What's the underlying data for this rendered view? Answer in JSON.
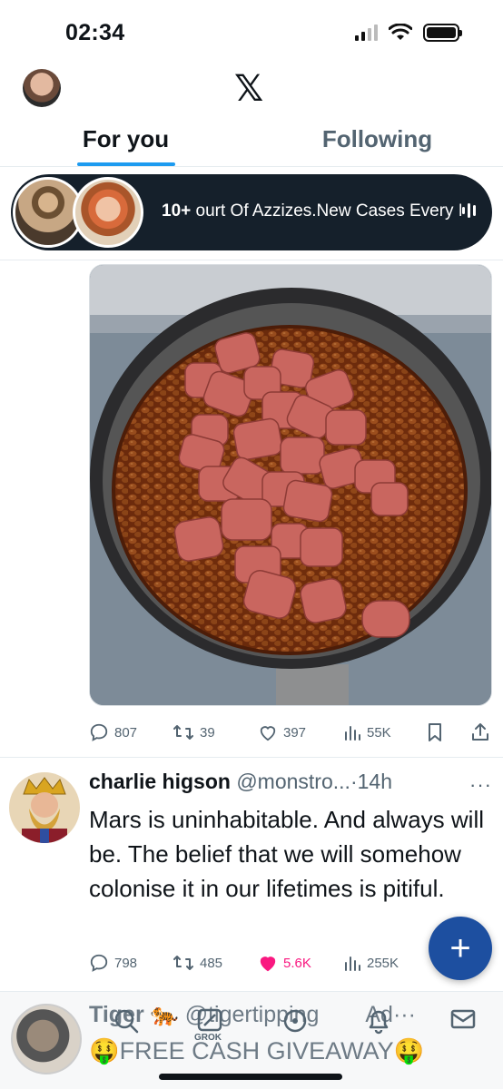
{
  "status": {
    "time": "02:34"
  },
  "header": {
    "logo": "𝕏"
  },
  "tabs": [
    {
      "label": "For you",
      "active": true
    },
    {
      "label": "Following",
      "active": false
    }
  ],
  "space": {
    "count": "10+",
    "title": "ourt Of Azzizes.New Cases Every Da"
  },
  "post1_actions": {
    "replies": "807",
    "reposts": "39",
    "likes": "397",
    "views": "55K"
  },
  "tweet": {
    "name": "charlie higson",
    "handle": "@monstro...",
    "time": "14h",
    "more": "···",
    "text": "Mars is uninhabitable. And always will be. The belief that we will somehow colonise it in our lifetimes is pitiful."
  },
  "post2_actions": {
    "replies": "798",
    "reposts": "485",
    "likes": "5.6K",
    "views": "255K",
    "liked_color": "#f91880"
  },
  "fab": {
    "label": "+"
  },
  "promo": {
    "name": "Tiger",
    "emoji": "🐅",
    "handle": "@tigertipping",
    "ad_label": "Ad",
    "more": "···",
    "headline": "FREE CASH GIVEAWAY",
    "money_emoji": "🤑"
  },
  "bottom_nav": {
    "grok_label": "GROK"
  },
  "colors": {
    "accent": "#1d9bf0",
    "fab": "#1d4fa0",
    "like": "#f91880"
  },
  "icons": [
    "signal-icon",
    "wifi-icon",
    "battery-icon",
    "reply-icon",
    "repost-icon",
    "like-icon",
    "views-icon",
    "bookmark-icon",
    "share-icon",
    "compose-icon",
    "search-icon",
    "grok-icon",
    "communities-icon",
    "bell-icon",
    "mail-icon"
  ]
}
